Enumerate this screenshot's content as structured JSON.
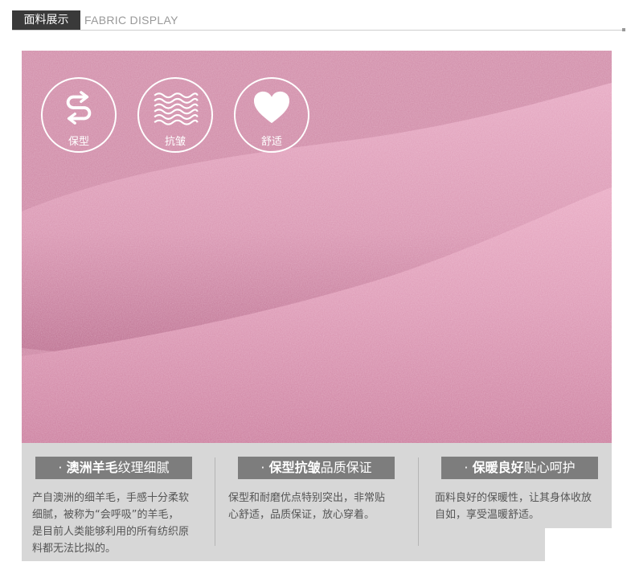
{
  "header": {
    "tag": "面料展示",
    "subtitle": "FABRIC DISPLAY"
  },
  "badges": [
    {
      "icon": "s-arrows-icon",
      "label": "保型"
    },
    {
      "icon": "waves-icon",
      "label": "抗皱"
    },
    {
      "icon": "heart-icon",
      "label": "舒适"
    }
  ],
  "features": [
    {
      "bullet": "·",
      "bold": "澳洲羊毛",
      "rest": "纹理细腻",
      "lines": [
        "产自澳洲的细羊毛，手感十分柔软",
        "细腻，被称为“会呼吸”的羊毛，",
        "是目前人类能够利用的所有纺织原",
        "料都无法比拟的。"
      ]
    },
    {
      "bullet": "·",
      "bold": "保型抗皱",
      "rest": "品质保证",
      "lines": [
        "保型和耐磨优点特别突出，非常贴",
        "心舒适，品质保证，放心穿着。"
      ]
    },
    {
      "bullet": "·",
      "bold": "保暖良好",
      "rest": "贴心呵护",
      "lines": [
        "面料良好的保暖性，让其身体收放",
        "自如，享受温暖舒适。"
      ]
    }
  ],
  "colors": {
    "fabric": "#d18aa8",
    "fabric_dark": "#b96a8c",
    "panel": "#d7d7d7",
    "chip": "#7d7d7d"
  }
}
